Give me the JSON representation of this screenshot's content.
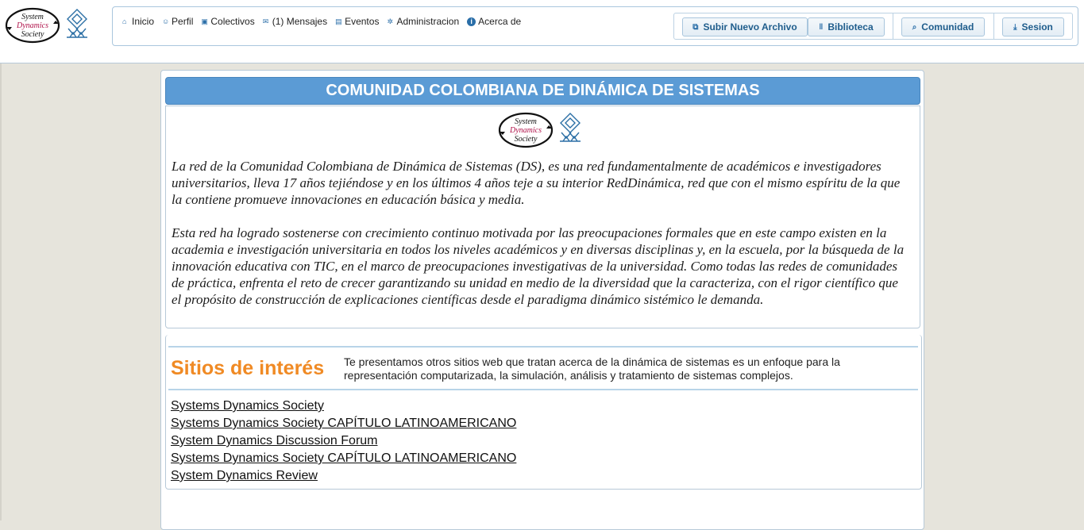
{
  "logos": {
    "sds_text": [
      "System",
      "Dynamics",
      "Society"
    ]
  },
  "nav": {
    "links": [
      {
        "label": "Inicio",
        "icon": "home-icon"
      },
      {
        "label": "Perfil",
        "icon": "user-icon"
      },
      {
        "label": "Colectivos",
        "icon": "group-icon"
      },
      {
        "label": "(1) Mensajes",
        "icon": "mail-icon"
      },
      {
        "label": "Eventos",
        "icon": "calendar-icon"
      },
      {
        "label": "Administracion",
        "icon": "gear-icon"
      },
      {
        "label": "Acerca de",
        "icon": "info-icon"
      }
    ],
    "buttons": {
      "upload": "Subir Nuevo Archivo",
      "library": "Biblioteca",
      "community": "Comunidad",
      "session": "Sesion"
    }
  },
  "main": {
    "title": "COMUNIDAD COLOMBIANA DE DINÁMICA DE SISTEMAS",
    "paragraph1": "La red de la Comunidad Colombiana de Dinámica de Sistemas (DS), es una red fundamentalmente de académicos e investigadores universitarios, lleva 17 años tejiéndose y en los últimos 4 años teje a su interior RedDinámica, red que con el mismo espíritu de la que la contiene promueve innovaciones en educación básica y media.",
    "paragraph2": "Esta red ha logrado sostenerse con crecimiento continuo motivada por las preocupaciones formales que en este campo existen en la academia e investigación universitaria en todos los niveles académicos y en diversas disciplinas y, en la escuela, por la búsqueda de la innovación educativa con TIC, en el marco de preocupaciones investigativas de la universidad. Como todas las redes de comunidades de práctica, enfrenta el reto de crecer garantizando su unidad en medio de la diversidad que la caracteriza, con el rigor científico que el propósito de construcción de explicaciones científicas desde el paradigma dinámico sistémico le demanda."
  },
  "sites": {
    "title": "Sitios de interés",
    "description": "Te presentamos otros sitios web que tratan acerca de la dinámica de sistemas es un enfoque para la representación computarizada, la simulación, análisis y tratamiento de sistemas complejos.",
    "links": [
      "Systems Dynamics Society",
      "Systems Dynamics Society CAPÍTULO LATINOAMERICANO",
      "System Dynamics Discussion Forum",
      "Systems Dynamics Society CAPÍTULO LATINOAMERICANO",
      "System Dynamics Review"
    ]
  },
  "colors": {
    "accent": "#5b9bd5",
    "sites_title": "#f08a24",
    "button_text": "#1f5d8c"
  }
}
